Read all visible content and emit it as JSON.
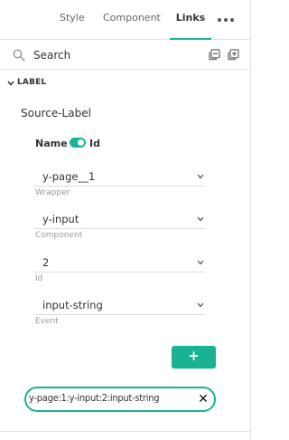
{
  "tabs": {
    "items": [
      {
        "label": "Style",
        "active": false
      },
      {
        "label": "Component",
        "active": false
      },
      {
        "label": "Links",
        "active": true
      }
    ],
    "more_icon": "more-dots-icon",
    "accent_color": "#19b394"
  },
  "search": {
    "placeholder": "Search",
    "icons": [
      "search-icon",
      "collapse-all-icon",
      "expand-all-icon"
    ]
  },
  "section": {
    "title": "LABEL",
    "expanded": true,
    "group_title": "Source-Label",
    "toggle": {
      "left_label": "Name",
      "right_label": "Id",
      "on": true
    },
    "fields": [
      {
        "value": "y-page__1",
        "label": "Wrapper"
      },
      {
        "value": "y-input",
        "label": "Component"
      },
      {
        "value": "2",
        "label": "Id"
      },
      {
        "value": "input-string",
        "label": "Event"
      }
    ],
    "add_label": "+",
    "chip": {
      "text": "y-page:1:y-input:2:input-string",
      "close_label": "✕"
    }
  }
}
